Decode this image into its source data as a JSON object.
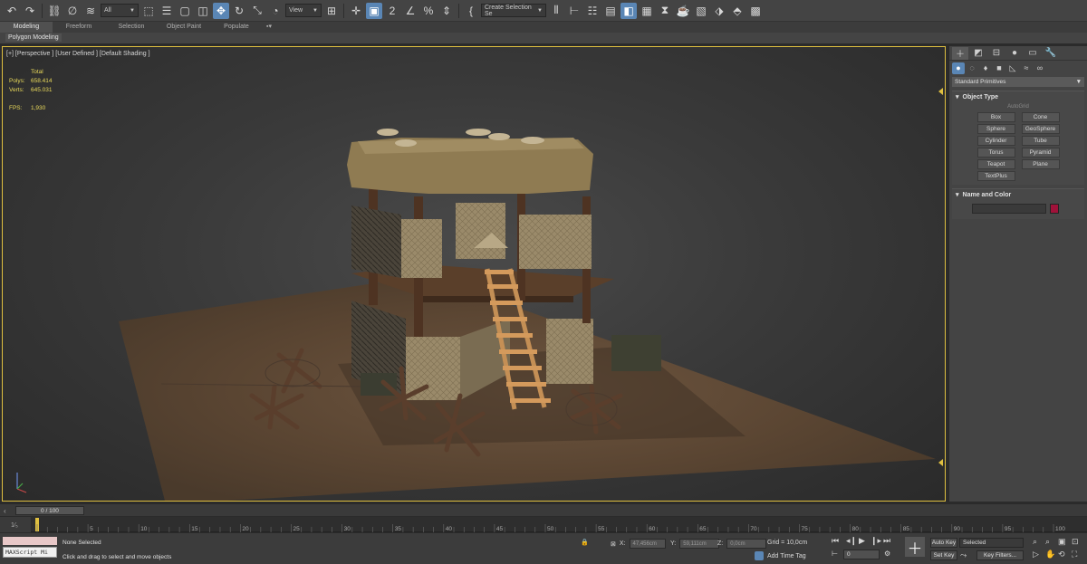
{
  "toolbar": {
    "filter_dropdown": "All",
    "view_dropdown": "View",
    "selection_set": "Create Selection Se"
  },
  "ribbon": {
    "tabs": [
      "Modeling",
      "Freeform",
      "Selection",
      "Object Paint",
      "Populate"
    ],
    "active_tab": "Modeling",
    "panel_label": "Polygon Modeling"
  },
  "viewport": {
    "label": "[+] [Perspective ] [User Defined ] [Default Shading ]",
    "stats": {
      "total_label": "Total",
      "polys_label": "Polys:",
      "polys_value": "658.414",
      "verts_label": "Verts:",
      "verts_value": "645.031",
      "fps_label": "FPS:",
      "fps_value": "1,930"
    }
  },
  "command_panel": {
    "category_dropdown": "Standard Primitives",
    "object_type": {
      "title": "Object Type",
      "autogrid": "AutoGrid",
      "buttons": [
        "Box",
        "Cone",
        "Sphere",
        "GeoSphere",
        "Cylinder",
        "Tube",
        "Torus",
        "Pyramid",
        "Teapot",
        "Plane",
        "TextPlus"
      ]
    },
    "name_and_color": {
      "title": "Name and Color",
      "color": "#a0123a"
    }
  },
  "timeline": {
    "frame_display": "0 / 100",
    "ticks": [
      "0",
      "5",
      "10",
      "15",
      "20",
      "25",
      "30",
      "35",
      "40",
      "45",
      "50",
      "55",
      "60",
      "65",
      "70",
      "75",
      "80",
      "85",
      "90",
      "95",
      "100"
    ]
  },
  "status": {
    "maxscript": "MAXScript Mi",
    "selection": "None Selected",
    "prompt": "Click and drag to select and move objects",
    "x_label": "X:",
    "x_value": "47,456cm",
    "y_label": "Y:",
    "y_value": "59,111cm",
    "z_label": "Z:",
    "z_value": "0,0cm",
    "grid": "Grid = 10,0cm",
    "add_time_tag": "Add Time Tag",
    "current_frame": "0",
    "auto_key": "Auto Key",
    "set_key": "Set Key",
    "selected_dropdown": "Selected",
    "key_filters": "Key Filters..."
  }
}
